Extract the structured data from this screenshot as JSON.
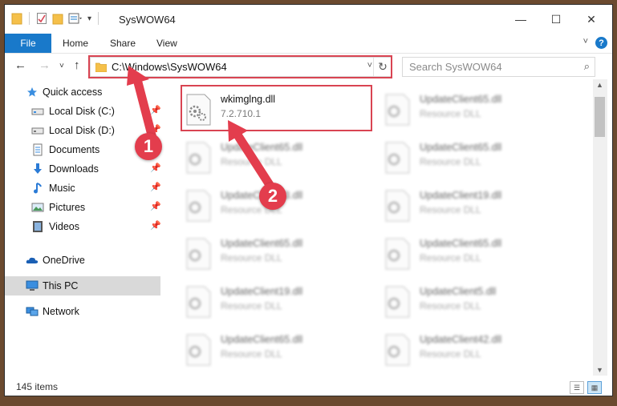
{
  "window": {
    "title": "SysWOW64"
  },
  "ribbon": {
    "tabs": [
      "File",
      "Home",
      "Share",
      "View"
    ],
    "help_label": "?"
  },
  "nav": {
    "address": "C:\\Windows\\SysWOW64",
    "search_placeholder": "Search SysWOW64"
  },
  "sidebar": {
    "items": [
      {
        "label": "Quick access",
        "icon": "star-icon"
      },
      {
        "label": "Local Disk (C:)",
        "icon": "drive-icon",
        "pinned": true
      },
      {
        "label": "Local Disk (D:)",
        "icon": "drive-icon",
        "pinned": true
      },
      {
        "label": "Documents",
        "icon": "documents-icon",
        "pinned": true
      },
      {
        "label": "Downloads",
        "icon": "download-icon",
        "pinned": true
      },
      {
        "label": "Music",
        "icon": "music-icon",
        "pinned": true
      },
      {
        "label": "Pictures",
        "icon": "pictures-icon",
        "pinned": true
      },
      {
        "label": "Videos",
        "icon": "videos-icon",
        "pinned": true
      },
      {
        "label": "OneDrive",
        "icon": "onedrive-icon"
      },
      {
        "label": "This PC",
        "icon": "computer-icon",
        "selected": true
      },
      {
        "label": "Network",
        "icon": "network-icon"
      }
    ]
  },
  "files": [
    {
      "name": "wkimglng.dll",
      "sub": "7.2.710.1",
      "highlighted": true
    },
    {
      "name": "UpdateClient65.dll",
      "sub": "Resource DLL"
    },
    {
      "name": "UpdateClient65.dll",
      "sub": "Resource DLL"
    },
    {
      "name": "UpdateClient65.dll",
      "sub": "Resource DLL"
    },
    {
      "name": "UpdateClient53.dll",
      "sub": "Resource DLL"
    },
    {
      "name": "UpdateClient19.dll",
      "sub": "Resource DLL"
    },
    {
      "name": "UpdateClient65.dll",
      "sub": "Resource DLL"
    },
    {
      "name": "UpdateClient65.dll",
      "sub": "Resource DLL"
    },
    {
      "name": "UpdateClient19.dll",
      "sub": "Resource DLL"
    },
    {
      "name": "UpdateClient5.dll",
      "sub": "Resource DLL"
    },
    {
      "name": "UpdateClient65.dll",
      "sub": "Resource DLL"
    },
    {
      "name": "UpdateClient42.dll",
      "sub": "Resource DLL"
    }
  ],
  "status": {
    "item_count": "145 items"
  },
  "callouts": [
    "1",
    "2"
  ],
  "colors": {
    "accent": "#1979ca",
    "highlight": "#d94452",
    "callout": "#e33d4d",
    "folder": "#f5c04a"
  }
}
